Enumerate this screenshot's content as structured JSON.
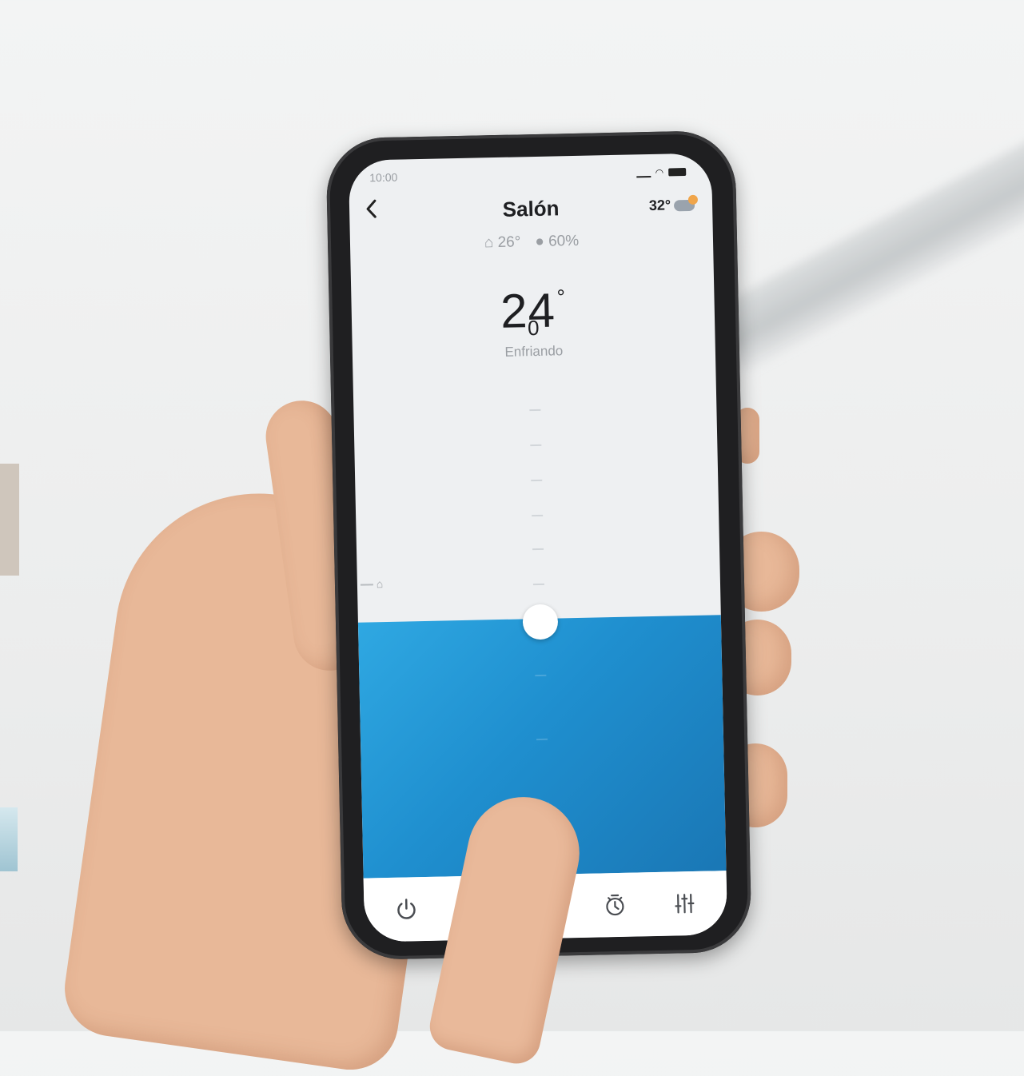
{
  "status_bar": {
    "time": "10:00"
  },
  "header": {
    "title": "Salón",
    "outside_temp": "32°",
    "weather_icon": "partly-cloudy-icon",
    "back_icon": "chevron-left-icon"
  },
  "metrics": {
    "indoor_temp": "26°",
    "humidity": "60%"
  },
  "thermostat": {
    "setpoint": "24",
    "degree_symbol": "°",
    "decimal": "0",
    "mode": "Enfriando"
  },
  "tabbar": {
    "items": [
      {
        "icon": "power-icon",
        "active": true
      },
      {
        "icon": "mode-icon",
        "active": false
      },
      {
        "icon": "fan-icon",
        "active": false
      },
      {
        "icon": "timer-icon",
        "active": false
      },
      {
        "icon": "settings-sliders-icon",
        "active": false
      }
    ]
  },
  "colors": {
    "accent": "#1f8fcf",
    "fill_top": "#2fa8e2",
    "fill_bottom": "#1a77b5",
    "screen_bg": "#eef0f2"
  }
}
